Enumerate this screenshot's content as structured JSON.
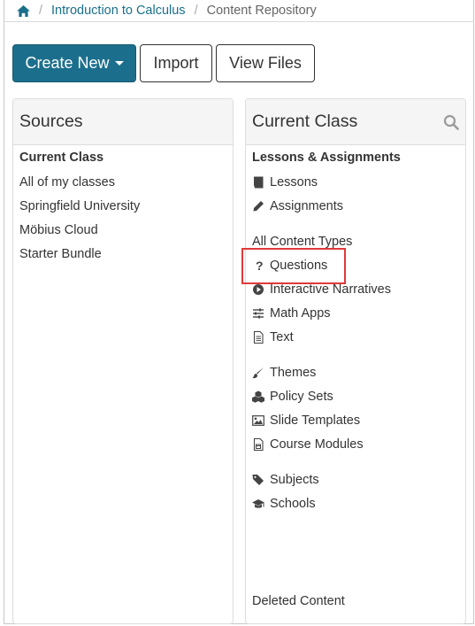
{
  "breadcrumb": {
    "home_icon": "home-icon",
    "course": "Introduction to Calculus",
    "current": "Content Repository"
  },
  "toolbar": {
    "create_new": "Create New",
    "import": "Import",
    "view_files": "View Files"
  },
  "sources": {
    "title": "Sources",
    "items": [
      "Current Class",
      "All of my classes",
      "Springfield University",
      "Möbius Cloud",
      "Starter Bundle"
    ]
  },
  "current_class": {
    "title": "Current Class",
    "section1_heading": "Lessons & Assignments",
    "lessons": "Lessons",
    "assignments": "Assignments",
    "section2_heading": "All Content Types",
    "questions": "Questions",
    "interactive_narratives": "Interactive Narratives",
    "math_apps": "Math Apps",
    "text": "Text",
    "themes": "Themes",
    "policy_sets": "Policy Sets",
    "slide_templates": "Slide Templates",
    "course_modules": "Course Modules",
    "subjects": "Subjects",
    "schools": "Schools",
    "deleted_content": "Deleted Content"
  },
  "colors": {
    "primary": "#1c6f8c",
    "link": "#1a6f8a",
    "highlight": "#e0393b"
  }
}
